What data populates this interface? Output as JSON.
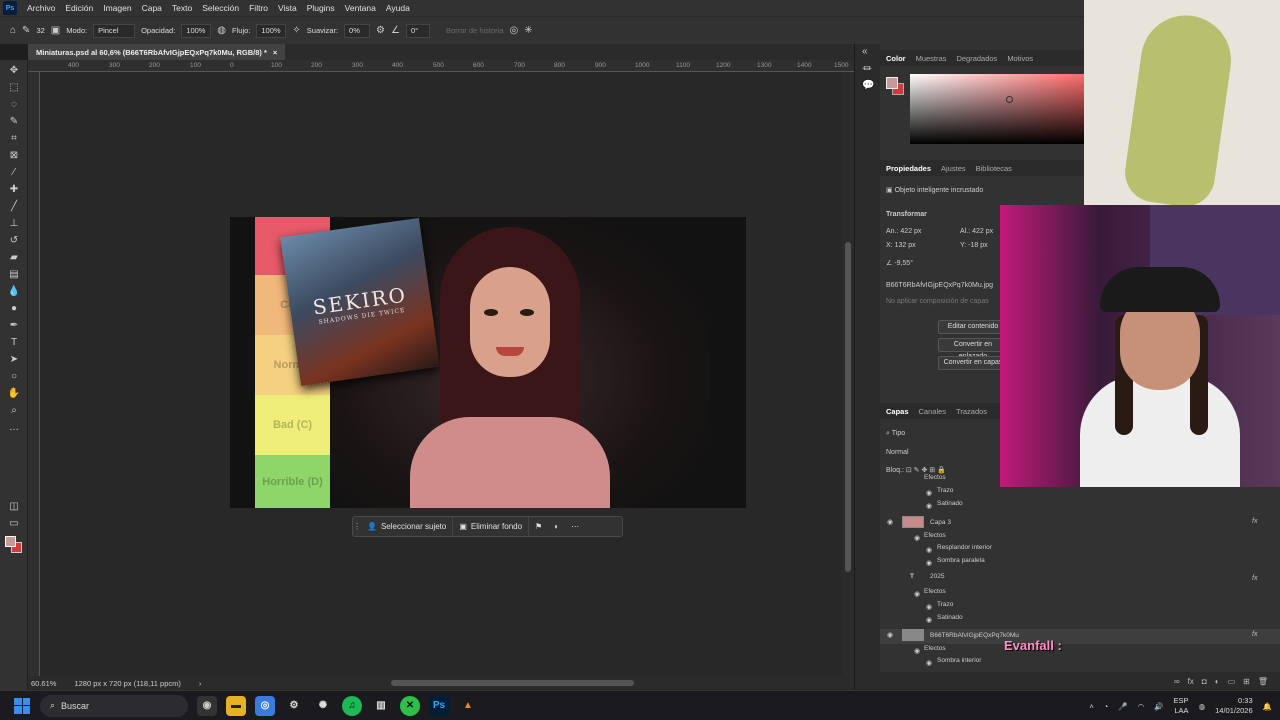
{
  "menubar": {
    "logo": "Ps",
    "items": [
      "Archivo",
      "Edición",
      "Imagen",
      "Capa",
      "Texto",
      "Selección",
      "Filtro",
      "Vista",
      "Plugins",
      "Ventana",
      "Ayuda"
    ]
  },
  "options": {
    "brush_size": "32",
    "modo_label": "Modo:",
    "modo_value": "Pincel",
    "opacidad_label": "Opacidad:",
    "opacidad_value": "100%",
    "flujo_label": "Flujo:",
    "flujo_value": "100%",
    "suavizar_label": "Suavizar:",
    "suavizar_value": "0%",
    "angle_value": "0°",
    "borrar_historia": "Borrar de historia"
  },
  "document": {
    "tab_title": "Miniaturas.psd al 60,6% (B66T6RbAfvIGjpEQxPq7k0Mu, RGB/8) *",
    "close": "×"
  },
  "ruler_labels": [
    "400",
    "300",
    "200",
    "100",
    "0",
    "100",
    "200",
    "300",
    "400",
    "500",
    "600",
    "700",
    "800",
    "900",
    "1000",
    "1100",
    "1200",
    "1300",
    "1400",
    "1500"
  ],
  "thumbnail": {
    "tiers": [
      "",
      "Cool",
      "Normal",
      "Bad (C)",
      "Horrible (D)"
    ],
    "game_title": "SEKIRO",
    "game_subtitle": "SHADOWS DIE TWICE"
  },
  "context_bar": {
    "select_subject": "Seleccionar sujeto",
    "remove_bg": "Eliminar fondo"
  },
  "status": {
    "zoom": "60.61%",
    "doc_size": "1280 px x 720 px (118,11 ppcm)",
    "arrow": "›"
  },
  "color_panel": {
    "tabs": [
      "Color",
      "Muestras",
      "Degradados",
      "Motivos"
    ],
    "fg_color": "#c79a98",
    "bg_color": "#d23b3b"
  },
  "properties": {
    "tabs": [
      "Propiedades",
      "Ajustes",
      "Bibliotecas"
    ],
    "object_type": "Objeto inteligente incrustado",
    "section": "Transformar",
    "an_label": "An.:",
    "an_value": "422 px",
    "al_label": "Al.:",
    "al_value": "422 px",
    "x_label": "X:",
    "x_value": "132 px",
    "y_label": "Y:",
    "y_value": "-18 px",
    "angle": "-9,55°",
    "file_name": "B66T6RbAfvIGjpEQxPq7k0Mu.jpg",
    "comp_placeholder": "No aplicar composición de capas",
    "btn_edit": "Editar contenido",
    "btn_linked": "Convertir en enlazado",
    "btn_layers": "Convertir en capas"
  },
  "layers": {
    "tabs": [
      "Capas",
      "Canales",
      "Trazados"
    ],
    "filter": "Tipo",
    "blend_mode": "Normal",
    "lock_label": "Bloq.:",
    "rows": [
      {
        "name": "Efectos",
        "indent": 2,
        "eye": false,
        "fx": false,
        "kind": "sub"
      },
      {
        "name": "Trazo",
        "indent": 3,
        "eye": false,
        "fx": false,
        "kind": "effect"
      },
      {
        "name": "Satinado",
        "indent": 3,
        "eye": false,
        "fx": false,
        "kind": "effect"
      },
      {
        "name": "Capa 3",
        "indent": 1,
        "eye": true,
        "fx": true,
        "kind": "layer"
      },
      {
        "name": "Efectos",
        "indent": 2,
        "eye": false,
        "fx": false,
        "kind": "sub"
      },
      {
        "name": "Resplandor interior",
        "indent": 3,
        "eye": false,
        "fx": false,
        "kind": "effect"
      },
      {
        "name": "Sombra paralela",
        "indent": 3,
        "eye": false,
        "fx": false,
        "kind": "effect"
      },
      {
        "name": "2025",
        "indent": 1,
        "eye": false,
        "fx": true,
        "kind": "text"
      },
      {
        "name": "Efectos",
        "indent": 2,
        "eye": false,
        "fx": false,
        "kind": "sub"
      },
      {
        "name": "Trazo",
        "indent": 3,
        "eye": false,
        "fx": false,
        "kind": "effect"
      },
      {
        "name": "Satinado",
        "indent": 3,
        "eye": false,
        "fx": false,
        "kind": "effect"
      },
      {
        "name": "B66T6RbAfvIGjpEQxPq7k0Mu",
        "indent": 1,
        "eye": true,
        "fx": true,
        "kind": "smart"
      },
      {
        "name": "Efectos",
        "indent": 2,
        "eye": false,
        "fx": false,
        "kind": "sub"
      },
      {
        "name": "Sombra interior",
        "indent": 3,
        "eye": false,
        "fx": false,
        "kind": "effect"
      }
    ],
    "fx_label": "fx"
  },
  "overlay": {
    "chat_name": "Evanfall :"
  },
  "taskbar": {
    "search": "Buscar",
    "lang": "ESP",
    "layout": "LAA",
    "time": "0:33",
    "date": "14/01/2026"
  }
}
